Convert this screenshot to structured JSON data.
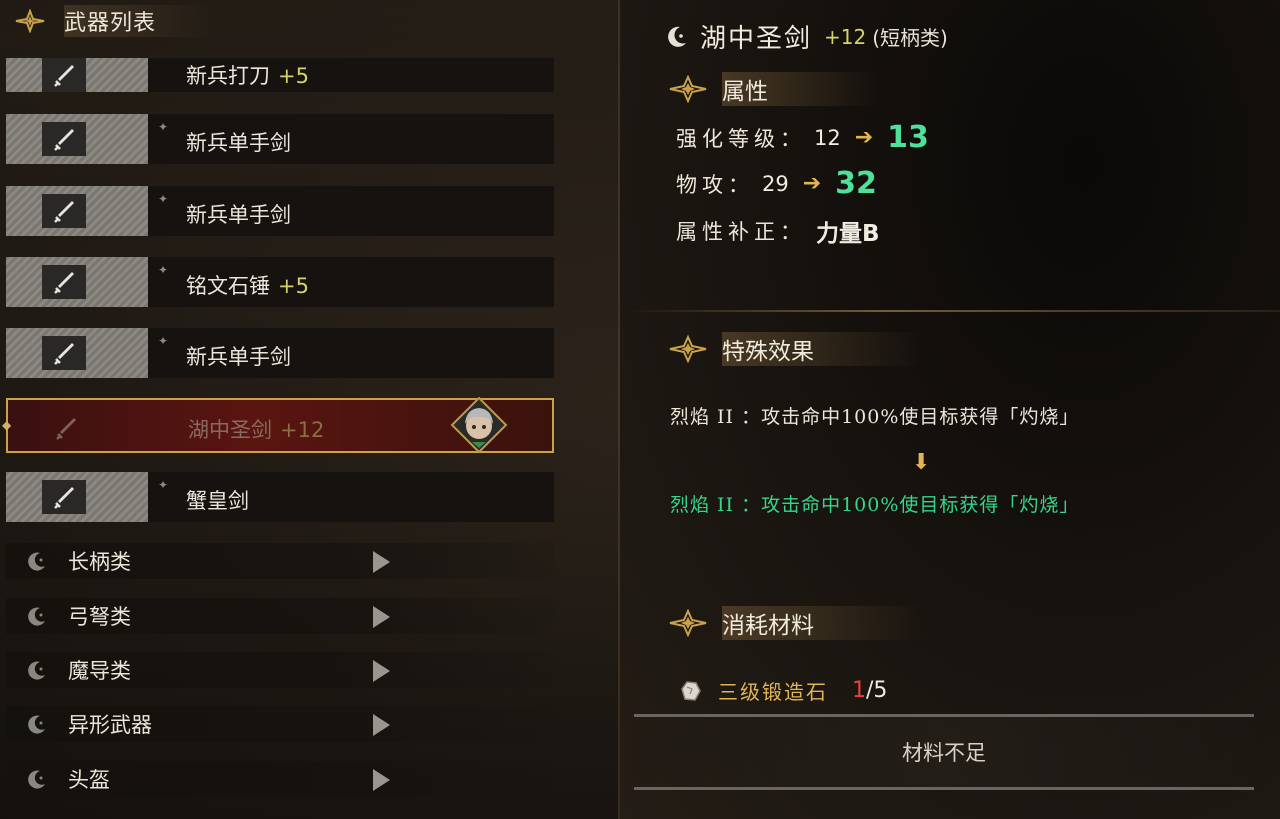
{
  "left": {
    "title": "武器列表",
    "weapons": [
      {
        "name": "新兵打刀",
        "plus": "+5"
      },
      {
        "name": "新兵单手剑",
        "plus": ""
      },
      {
        "name": "新兵单手剑",
        "plus": ""
      },
      {
        "name": "铭文石锤",
        "plus": "+5"
      },
      {
        "name": "新兵单手剑",
        "plus": ""
      },
      {
        "name": "湖中圣剑",
        "plus": "+12",
        "selected": true
      },
      {
        "name": "蟹皇剑",
        "plus": ""
      }
    ],
    "categories": [
      "长柄类",
      "弓弩类",
      "魔导类",
      "异形武器",
      "头盔"
    ]
  },
  "detail": {
    "title": "湖中圣剑",
    "plus": "+12",
    "type": "(短柄类)",
    "attr_header": "属性",
    "stats": {
      "level_label": "强化等级：",
      "level_old": "12",
      "level_new": "13",
      "atk_label": "物攻：",
      "atk_old": "29",
      "atk_new": "32",
      "scaling_label": "属性补正：",
      "scaling_value": "力量B"
    },
    "special_header": "特殊效果",
    "effect_old": "烈焰 II ：攻击命中100%使目标获得「灼烧」",
    "effect_new": "烈焰 II ：攻击命中100%使目标获得「灼烧」",
    "materials_header": "消耗材料",
    "material": {
      "name": "三级锻造石",
      "have": "1",
      "need": "/5"
    },
    "craft_label": "材料不足"
  },
  "colors": {
    "accent_gold": "#e2b456",
    "upgrade_green": "#4fe09a",
    "plus_yellow": "#d6d36a",
    "insufficient_red": "#e84040",
    "selected_border": "#c9a24a"
  }
}
